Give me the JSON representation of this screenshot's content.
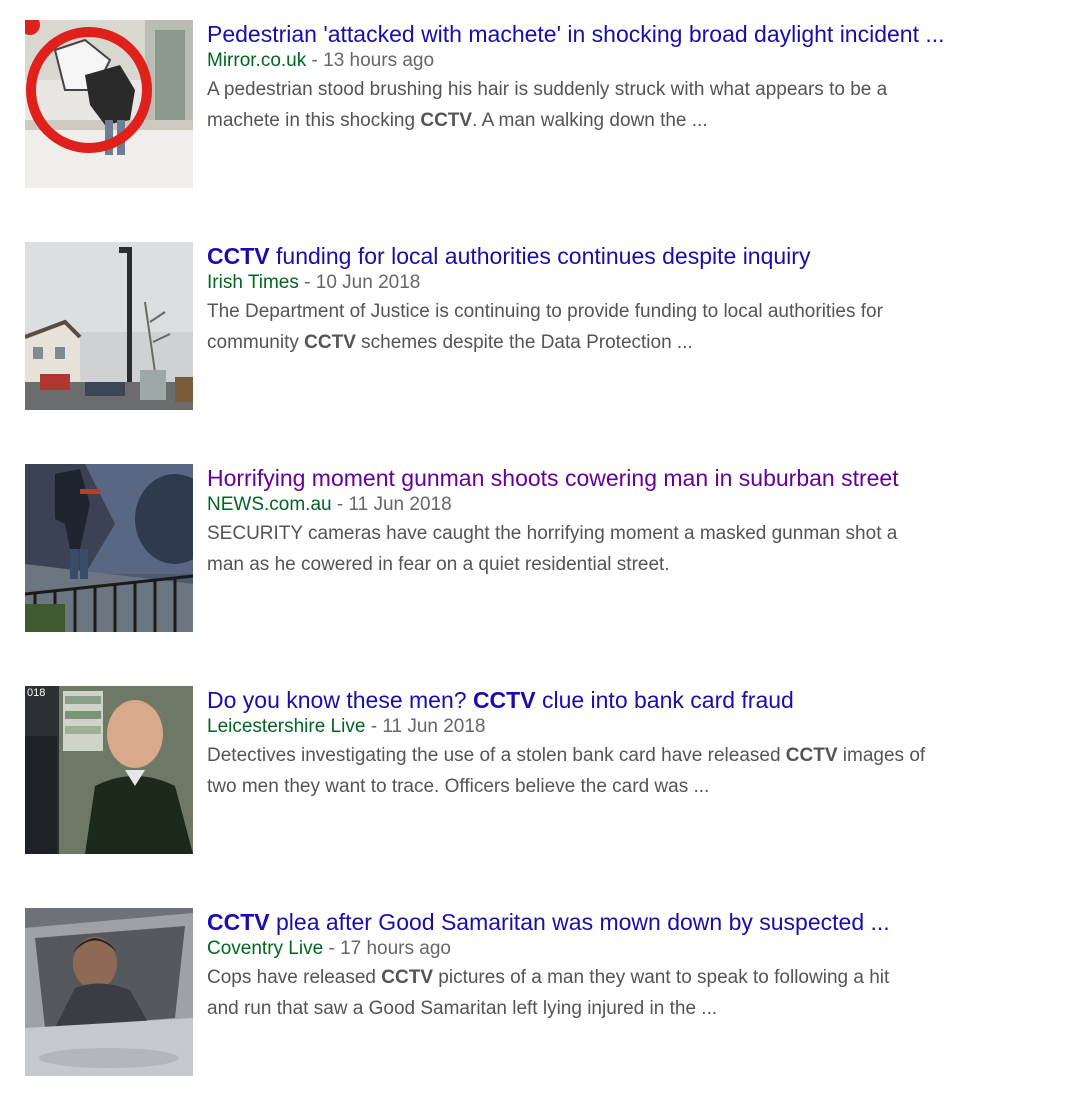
{
  "results": [
    {
      "title_parts": [
        "Pedestrian 'attacked with machete' in shocking broad daylight incident ..."
      ],
      "title_bold": [],
      "source": "Mirror.co.uk",
      "separator": " - ",
      "time": "13 hours ago",
      "snippet": {
        "line1": "A pedestrian stood brushing his hair is suddenly struck with what appears to be a",
        "line2_pre": "machete in this shocking ",
        "line2_bold": "CCTV",
        "line2_post": ". A man walking down the ..."
      }
    },
    {
      "title_bold": "CCTV",
      "title_rest": " funding for local authorities continues despite inquiry",
      "source": "Irish Times",
      "separator": " - ",
      "time": "10 Jun 2018",
      "snippet": {
        "line1": "The Department of Justice is continuing to provide funding to local authorities for",
        "line2_pre": "community ",
        "line2_bold": "CCTV",
        "line2_post": " schemes despite the Data Protection ..."
      }
    },
    {
      "title": "Horrifying moment gunman shoots cowering man in suburban street",
      "source": "NEWS.com.au",
      "separator": " - ",
      "time": "11 Jun 2018",
      "snippet": {
        "line1": "SECURITY cameras have caught the horrifying moment a masked gunman shot a",
        "line2": "man as he cowered in fear on a quiet residential street."
      }
    },
    {
      "title_pre": "Do you know these men? ",
      "title_bold": "CCTV",
      "title_post": " clue into bank card fraud",
      "source": "Leicestershire Live",
      "separator": " - ",
      "time": "11 Jun 2018",
      "snippet": {
        "line1_pre": "Detectives investigating the use of a stolen bank card have released ",
        "line1_bold": "CCTV",
        "line1_post": " images of",
        "line2": "two men they want to trace. Officers believe the card was ..."
      }
    },
    {
      "title_bold": "CCTV",
      "title_rest": " plea after Good Samaritan was mown down by suspected ...",
      "source": "Coventry Live",
      "separator": " - ",
      "time": "17 hours ago",
      "snippet": {
        "line1_pre": "Cops have released ",
        "line1_bold": "CCTV",
        "line1_post": " pictures of a man they want to speak to following a hit",
        "line2": "and run that saw a Good Samaritan left lying injured in the ..."
      }
    }
  ],
  "thumbnail_badge": "018",
  "colors": {
    "title_link": "#1a0dab",
    "title_visited": "#660099",
    "source": "#006621",
    "meta": "#666666",
    "snippet": "#545454"
  }
}
